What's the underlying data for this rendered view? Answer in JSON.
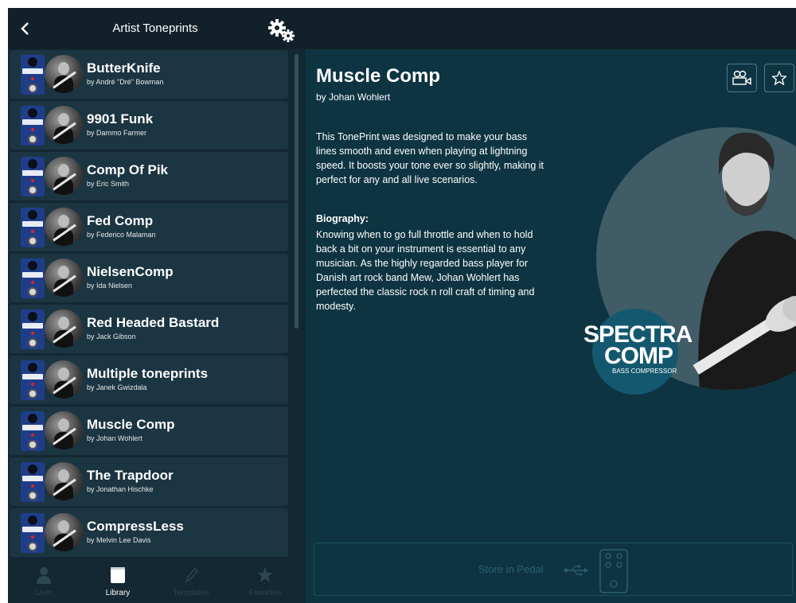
{
  "topbar": {
    "title": "Artist Toneprints",
    "back_icon": "chevron-left-icon",
    "settings_icon": "gears-icon"
  },
  "toneprints": [
    {
      "name": "ButterKnife",
      "artist": "by André \"Dré\" Bowman"
    },
    {
      "name": "9901 Funk",
      "artist": "by Dammo Farmer"
    },
    {
      "name": "Comp Of Pik",
      "artist": "by Eric Smith"
    },
    {
      "name": "Fed Comp",
      "artist": "by Federico Malaman"
    },
    {
      "name": "NielsenComp",
      "artist": "by Ida Nielsen"
    },
    {
      "name": "Red Headed Bastard",
      "artist": "by Jack Gibson"
    },
    {
      "name": "Multiple toneprints",
      "artist": "by Janek Gwizdala"
    },
    {
      "name": "Muscle Comp",
      "artist": "by Johan Wohlert"
    },
    {
      "name": "The Trapdoor",
      "artist": "by Jonathan Hischke"
    },
    {
      "name": "CompressLess",
      "artist": "by Melvin Lee Davis"
    }
  ],
  "tabs": [
    {
      "label": "User",
      "icon": "user-icon"
    },
    {
      "label": "Library",
      "icon": "book-icon",
      "active": true
    },
    {
      "label": "Templates",
      "icon": "pencil-icon"
    },
    {
      "label": "Favorites",
      "icon": "star-icon"
    }
  ],
  "detail": {
    "title": "Muscle Comp",
    "artist": "by Johan Wohlert",
    "description": "This TonePrint was designed to make your bass lines smooth and even when playing at lightning speed. It boosts your tone ever so slightly, making it perfect for any and all live scenarios.",
    "bio_heading": "Biography:",
    "bio": "Knowing when to go full throttle and when to hold back a bit on your instrument is essential to any musician. As the highly regarded bass player for Danish art rock band Mew, Johan Wohlert has perfected the classic rock n roll craft of timing and modesty.",
    "logo_line1": "SPECTRA",
    "logo_line2": "COMP",
    "logo_line3": "BASS COMPRESSOR",
    "store_label": "Store in Pedal",
    "video_icon": "video-camera-icon",
    "favorite_icon": "star-outline-icon"
  },
  "colors": {
    "background": "#0f2a36",
    "panel": "#0e3442",
    "row": "#1c3542",
    "accent": "#14586f"
  }
}
